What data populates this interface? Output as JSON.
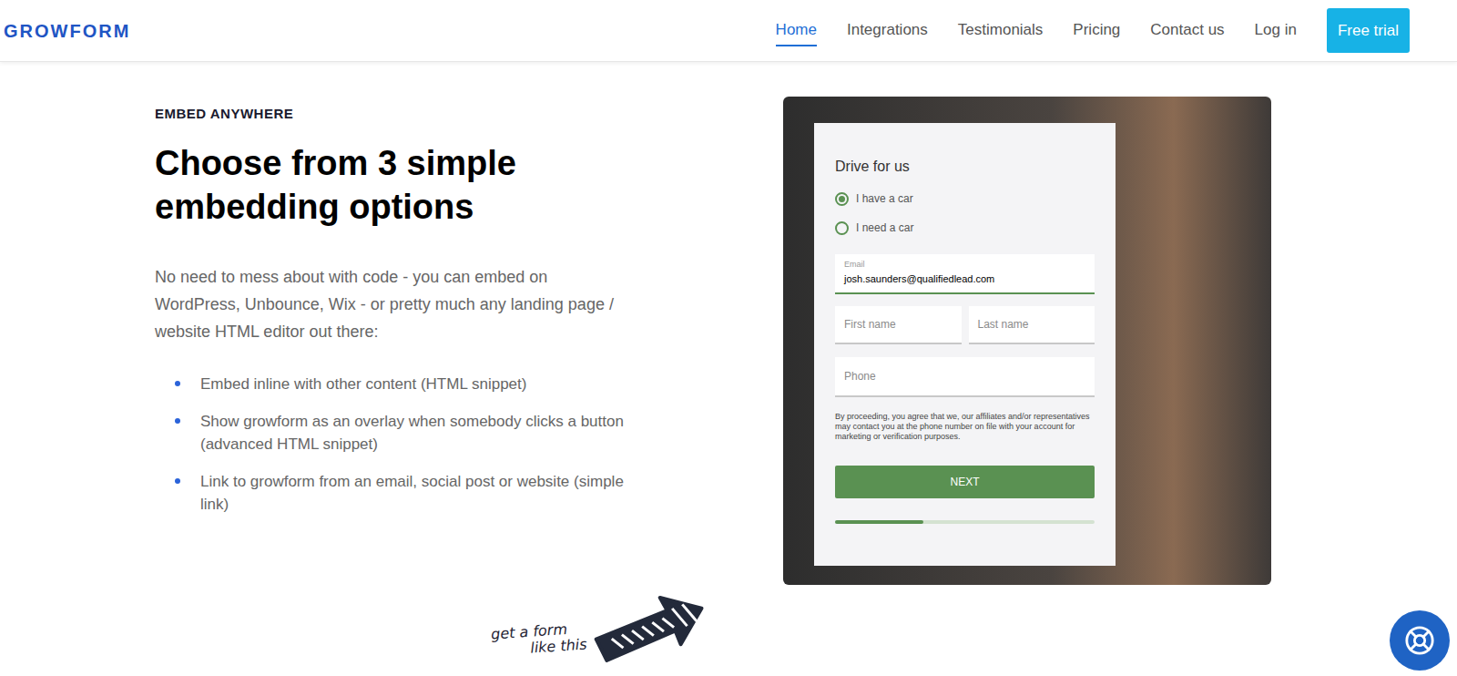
{
  "logo": "GROWFORM",
  "nav": [
    {
      "label": "Home",
      "selected": true
    },
    {
      "label": "Integrations",
      "selected": false
    },
    {
      "label": "Testimonials",
      "selected": false
    },
    {
      "label": "Pricing",
      "selected": false
    },
    {
      "label": "Contact us",
      "selected": false
    },
    {
      "label": "Log in",
      "selected": false
    }
  ],
  "cta": "Free trial",
  "section": {
    "eyebrow": "EMBED ANYWHERE",
    "title": "Choose from 3 simple embedding options",
    "intro": "No need to mess about with code - you can embed on WordPress, Unbounce, Wix - or pretty much any landing page / website HTML editor out there:",
    "bullets": [
      "Embed inline with other content (HTML snippet)",
      "Show growform as an overlay when somebody clicks a button (advanced HTML snippet)",
      "Link to growform from an email, social post or website (simple link)"
    ]
  },
  "form": {
    "title": "Drive for us",
    "options": [
      {
        "label": "I have a car",
        "selected": true
      },
      {
        "label": "I need a car",
        "selected": false
      }
    ],
    "email": {
      "label": "Email",
      "value": "josh.saunders@qualifiedlead.com"
    },
    "first_name": {
      "placeholder": "First name"
    },
    "last_name": {
      "placeholder": "Last name"
    },
    "phone": {
      "placeholder": "Phone"
    },
    "disclaimer": "By proceeding, you agree that we, our affiliates and/or representatives may contact you at the phone number on file with your account for marketing or verification purposes.",
    "button": "NEXT",
    "progress": {
      "level": 0.34
    }
  },
  "callout": {
    "lines": [
      "get a form",
      "like this"
    ]
  }
}
